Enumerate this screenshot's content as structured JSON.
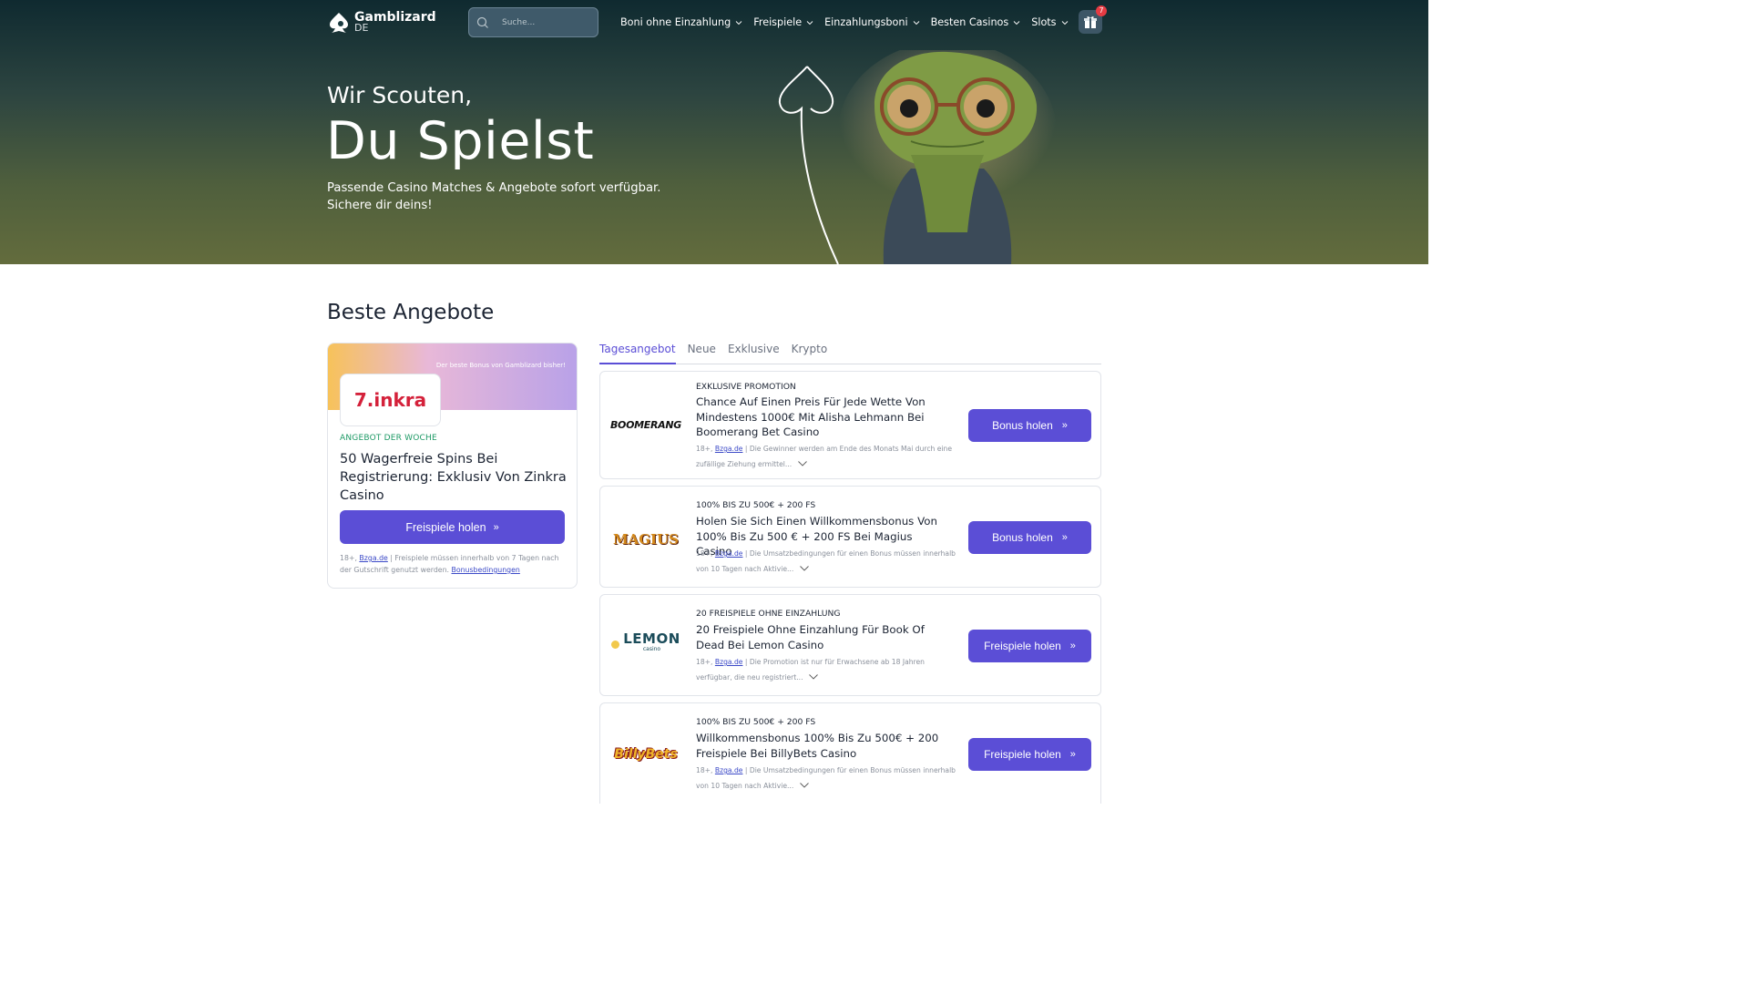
{
  "header": {
    "logo_name": "Gamblizard",
    "logo_sub": "DE",
    "search_placeholder": "Suche...",
    "menu": [
      {
        "label": "Boni ohne Einzahlung"
      },
      {
        "label": "Freispiele"
      },
      {
        "label": "Einzahlungsboni"
      },
      {
        "label": "Besten Casinos"
      },
      {
        "label": "Slots"
      }
    ],
    "gift_count": "7"
  },
  "hero": {
    "line1": "Wir Scouten,",
    "line2": "Du Spielst",
    "subtitle_1": "Passende Casino Matches & Angebote sofort verfügbar.",
    "subtitle_2": "Sichere dir deins!"
  },
  "section": {
    "title": "Beste Angebote"
  },
  "featured": {
    "banner_text": "Der beste Bonus von Gamblizard bisher!",
    "logo_text": "7.inkra",
    "tag": "ANGEBOT DER WOCHE",
    "title": "50 Wagerfreie Spins Bei Registrierung: Exklusiv Von Zinkra Casino",
    "button": "Freispiele holen",
    "note_prefix": "18+,",
    "note_link": "Bzga.de",
    "note_text": "| Freispiele müssen innerhalb von 7 Tagen nach der Gutschrift genutzt werden.",
    "note_link2": "Bonusbedingungen"
  },
  "tabs": [
    {
      "label": "Tagesangebot"
    },
    {
      "label": "Neue"
    },
    {
      "label": "Exklusive"
    },
    {
      "label": "Krypto"
    }
  ],
  "offers": [
    {
      "logo": "BOOMERANG",
      "tag": "EXKLUSIVE PROMOTION",
      "title": "Chance Auf Einen Preis Für Jede Wette Von Mindestens 1000€ Mit Alisha Lehmann Bei Boomerang Bet Casino",
      "note_prefix": "18+,",
      "note_link": "Bzga.de",
      "note_text": "| Die Gewinner werden am Ende des Monats Mai durch eine zufällige Ziehung ermittel...",
      "button": "Bonus holen"
    },
    {
      "logo": "MAGIUS",
      "tag": "100% BIS ZU 500€ + 200 FS",
      "title": "Holen Sie Sich Einen Willkommensbonus Von 100% Bis Zu 500 € + 200 FS Bei Magius Casino",
      "note_prefix": "18+,",
      "note_link": "Bzga.de",
      "note_text": "| Die Umsatzbedingungen für einen Bonus müssen innerhalb von 10 Tagen nach Aktivie...",
      "button": "Bonus holen"
    },
    {
      "logo": "LEMON",
      "logo_sub": "casino",
      "tag": "20 FREISPIELE OHNE EINZAHLUNG",
      "title": "20 Freispiele Ohne Einzahlung Für Book Of Dead Bei Lemon Casino",
      "note_prefix": "18+,",
      "note_link": "Bzga.de",
      "note_text": "| Die Promotion ist nur für Erwachsene ab 18 Jahren verfügbar, die neu registriert...",
      "button": "Freispiele holen"
    },
    {
      "logo": "BillyBets",
      "tag": "100% BIS ZU 500€ + 200 FS",
      "title": "Willkommensbonus 100% Bis Zu 500€ + 200 Freispiele Bei BillyBets Casino",
      "note_prefix": "18+,",
      "note_link": "Bzga.de",
      "note_text": "| Die Umsatzbedingungen für einen Bonus müssen innerhalb von 10 Tagen nach Aktivie...",
      "button": "Freispiele holen"
    }
  ],
  "colors": {
    "accent": "#5b4ed6",
    "tag_green": "#1e9a66",
    "hero_top": "#0f2a30",
    "hero_bottom": "#636c3d"
  }
}
